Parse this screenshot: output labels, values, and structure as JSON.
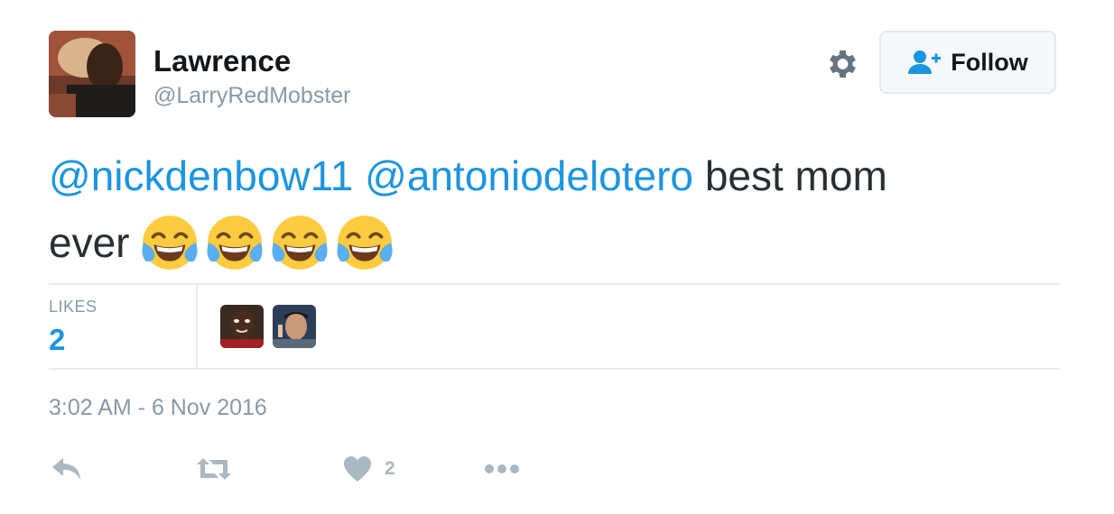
{
  "author": {
    "name": "Lawrence",
    "handle": "@LarryRedMobster"
  },
  "follow_button": {
    "label": "Follow"
  },
  "tweet": {
    "mention_1": "@nickdenbow11",
    "mention_2": "@antoniodelotero",
    "text_part_1": "best mom",
    "text_part_2": "ever",
    "emoji_name": "face-with-tears-of-joy",
    "emoji_count": 4
  },
  "stats": {
    "likes_label": "LIKES",
    "likes_count": "2"
  },
  "timestamp": "3:02 AM - 6 Nov 2016",
  "actions": {
    "like_count": "2"
  },
  "colors": {
    "link": "#1b95e0",
    "text": "#292f33",
    "muted": "#8899a6",
    "icon": "#aab8c2"
  }
}
